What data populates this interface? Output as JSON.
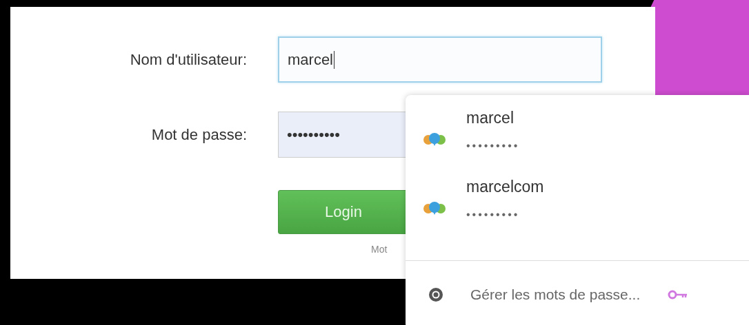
{
  "form": {
    "fields": [
      {
        "label": "Nom d'utilisateur:",
        "value": "marcel",
        "focused": true,
        "autofilled": false
      },
      {
        "label": "Mot de passe:",
        "value": "••••••••••",
        "focused": false,
        "autofilled": true
      }
    ],
    "login_button": "Login",
    "forgot_link": "Mot"
  },
  "autocomplete": {
    "suggestions": [
      {
        "username": "marcel",
        "password": "•••••••••"
      },
      {
        "username": "marcelcom",
        "password": "•••••••••"
      }
    ],
    "manage_link": "Gérer les mots de passe..."
  }
}
